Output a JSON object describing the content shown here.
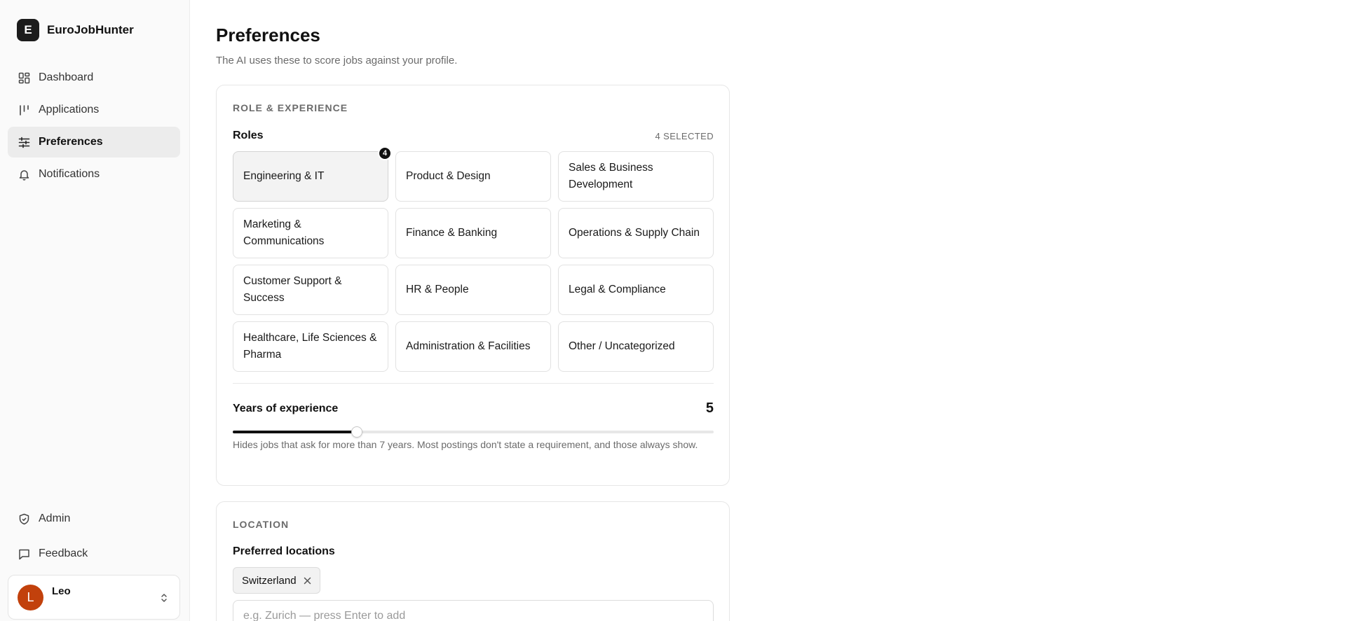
{
  "app": {
    "logo_letter": "E",
    "name": "EuroJobHunter"
  },
  "sidebar": {
    "items": [
      {
        "label": "Dashboard",
        "icon": "dashboard-icon"
      },
      {
        "label": "Applications",
        "icon": "applications-icon"
      },
      {
        "label": "Preferences",
        "icon": "sliders-icon",
        "active": true
      },
      {
        "label": "Notifications",
        "icon": "bell-icon"
      }
    ],
    "bottom_items": [
      {
        "label": "Admin",
        "icon": "shield-icon"
      },
      {
        "label": "Feedback",
        "icon": "message-icon"
      }
    ],
    "user": {
      "initial": "L",
      "name": "Leo",
      "avatar_color": "#c2410c"
    }
  },
  "page": {
    "title": "Preferences",
    "subtitle": "The AI uses these to score jobs against your profile."
  },
  "role_section": {
    "label": "ROLE & EXPERIENCE",
    "roles_title": "Roles",
    "selected_count": "4 SELECTED",
    "roles": [
      {
        "label": "Engineering & IT",
        "selected": true,
        "badge": "4"
      },
      {
        "label": "Product & Design"
      },
      {
        "label": "Sales & Business Development"
      },
      {
        "label": "Marketing & Communications"
      },
      {
        "label": "Finance & Banking"
      },
      {
        "label": "Operations & Supply Chain"
      },
      {
        "label": "Customer Support & Success"
      },
      {
        "label": "HR & People"
      },
      {
        "label": "Legal & Compliance"
      },
      {
        "label": "Healthcare, Life Sciences & Pharma"
      },
      {
        "label": "Administration & Facilities"
      },
      {
        "label": "Other / Uncategorized"
      }
    ],
    "experience_label": "Years of experience",
    "experience_value": "5",
    "experience_slider_fraction": 0.258,
    "experience_help": "Hides jobs that ask for more than 7 years. Most postings don't state a requirement, and those always show."
  },
  "location_section": {
    "label": "LOCATION",
    "preferred_title": "Preferred locations",
    "chips": [
      "Switzerland"
    ],
    "input_placeholder": "e.g. Zurich — press Enter to add"
  }
}
